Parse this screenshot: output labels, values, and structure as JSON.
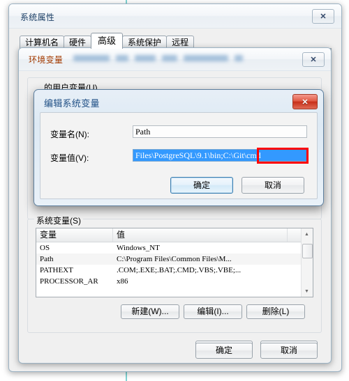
{
  "system_properties": {
    "title": "系统属性",
    "close_label": "✕",
    "tabs": [
      {
        "label": "计算机名",
        "active": false
      },
      {
        "label": "硬件",
        "active": false
      },
      {
        "label": "高级",
        "active": true
      },
      {
        "label": "系统保护",
        "active": false
      },
      {
        "label": "远程",
        "active": false
      }
    ],
    "ok_label": "确定",
    "cancel_label": "取消"
  },
  "environment_variables": {
    "title": "环境变量",
    "redacted_note": "",
    "close_label": "✕",
    "user_vars_label": "的用户变量(U)",
    "system_vars_label": "系统变量(S)",
    "columns": [
      "变量",
      "值"
    ],
    "rows": [
      {
        "name": "OS",
        "value": "Windows_NT"
      },
      {
        "name": "Path",
        "value": "C:\\Program Files\\Common Files\\M..."
      },
      {
        "name": "PATHEXT",
        "value": ".COM;.EXE;.BAT;.CMD;.VBS;.VBE;..."
      },
      {
        "name": "PROCESSOR_AR",
        "value": "x86"
      }
    ],
    "new_label": "新建(W)...",
    "edit_label": "编辑(I)...",
    "delete_label": "删除(L)"
  },
  "edit_system_variable": {
    "title": "编辑系统变量",
    "close_label": "✕",
    "name_label": "变量名(N):",
    "name_value": "Path",
    "value_label": "变量值(V):",
    "value_text": "Files\\PostgreSQL\\9.1\\bin",
    "value_highlight": ";C:\\Git\\cmd",
    "ok_label": "确定",
    "cancel_label": "取消",
    "highlight_color": "#ff0000",
    "selection_color": "#3399ff"
  },
  "scrollbar": {
    "up_arrow": "▲",
    "down_arrow": "▼"
  }
}
